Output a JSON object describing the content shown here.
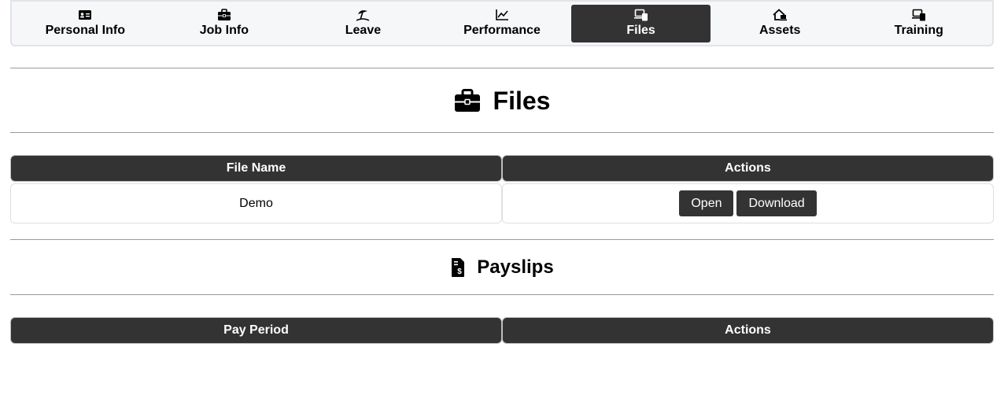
{
  "tabs": [
    {
      "label": "Personal Info",
      "icon": "id-card-icon"
    },
    {
      "label": "Job Info",
      "icon": "briefcase-icon"
    },
    {
      "label": "Leave",
      "icon": "beach-umbrella-icon"
    },
    {
      "label": "Performance",
      "icon": "line-chart-icon"
    },
    {
      "label": "Files",
      "icon": "devices-icon",
      "active": true
    },
    {
      "label": "Assets",
      "icon": "home-laptop-icon"
    },
    {
      "label": "Training",
      "icon": "devices-icon"
    }
  ],
  "files_section": {
    "title": "Files",
    "icon": "briefcase-icon",
    "columns": [
      "File Name",
      "Actions"
    ],
    "rows": [
      {
        "file_name": "Demo",
        "actions": [
          "Open",
          "Download"
        ]
      }
    ]
  },
  "payslips_section": {
    "title": "Payslips",
    "icon": "invoice-dollar-icon",
    "columns": [
      "Pay Period",
      "Actions"
    ],
    "rows": []
  },
  "colors": {
    "dark": "#333333",
    "tabbar_bg": "#f6f7f9",
    "divider": "#9a9a9a"
  }
}
